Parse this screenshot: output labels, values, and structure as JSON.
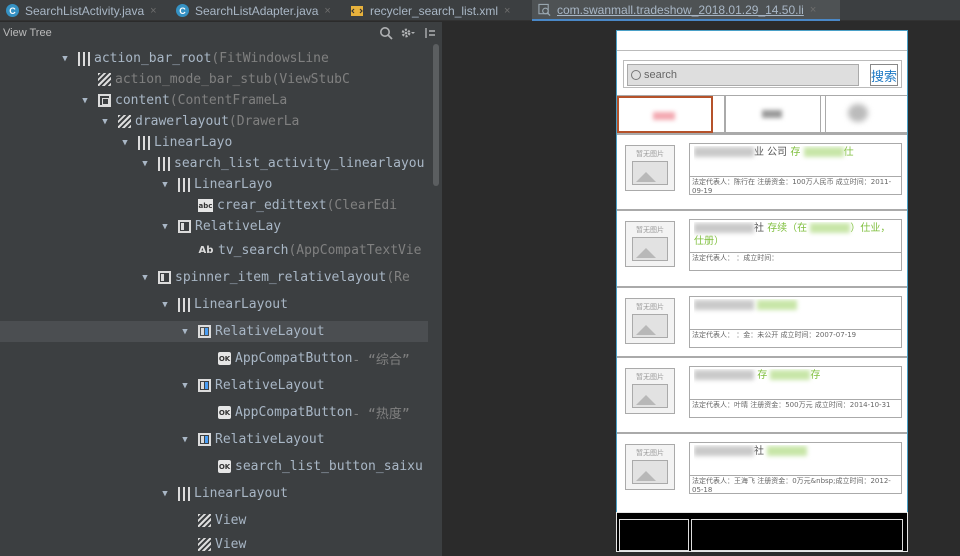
{
  "tabs": [
    {
      "label": "SearchListActivity.java",
      "icon": "c"
    },
    {
      "label": "SearchListAdapter.java",
      "icon": "c"
    },
    {
      "label": "recycler_search_list.xml",
      "icon": "xml"
    },
    {
      "label": "com.swanmall.tradeshow_2018.01.29_14.50.li",
      "icon": "img"
    }
  ],
  "view_tree": {
    "title": "View Tree",
    "rows": [
      {
        "name": "action_bar_root",
        "meta": " (FitWindowsLine",
        "icon": "linear",
        "indent": 60,
        "arrow": true
      },
      {
        "name": "action_mode_bar_stub",
        "meta": " (ViewStubC",
        "icon": "stub",
        "indent": 80,
        "arrow": false,
        "dim": true
      },
      {
        "name": "content",
        "meta": " (ContentFrameLa",
        "icon": "frame",
        "indent": 80,
        "arrow": true
      },
      {
        "name": "drawerlayout",
        "meta": " (DrawerLa",
        "icon": "stub",
        "indent": 100,
        "arrow": true
      },
      {
        "name": "LinearLayo",
        "meta": "",
        "icon": "linear",
        "indent": 120,
        "arrow": true
      },
      {
        "name": "search_list_activity_linearlayou",
        "meta": "",
        "icon": "linear",
        "indent": 140,
        "arrow": true
      },
      {
        "name": "LinearLayo",
        "meta": "",
        "icon": "linear",
        "indent": 160,
        "arrow": true
      },
      {
        "name": "crear_edittext",
        "meta": " (ClearEdi",
        "icon": "abc",
        "indent": 180,
        "arrow": false
      },
      {
        "name": "RelativeLay",
        "meta": "",
        "icon": "rel",
        "indent": 160,
        "arrow": true
      },
      {
        "name": "tv_search",
        "meta": " (AppCompatTextVie",
        "icon": "ab",
        "indent": 180,
        "arrow": false
      },
      {
        "name": "spinner_item_relativelayout",
        "meta": " (Re",
        "icon": "rel",
        "indent": 140,
        "arrow": true
      },
      {
        "name": "LinearLayout",
        "meta": "",
        "icon": "linear",
        "indent": 160,
        "arrow": true
      },
      {
        "name": "RelativeLayout",
        "meta": "",
        "icon": "relb",
        "indent": 180,
        "arrow": true,
        "selected": true
      },
      {
        "name": "AppCompatButton",
        "meta": " - “综合”",
        "icon": "ok",
        "indent": 200,
        "arrow": false
      },
      {
        "name": "RelativeLayout",
        "meta": "",
        "icon": "relb",
        "indent": 180,
        "arrow": true
      },
      {
        "name": "AppCompatButton",
        "meta": " - “热度”",
        "icon": "ok",
        "indent": 200,
        "arrow": false
      },
      {
        "name": "RelativeLayout",
        "meta": "",
        "icon": "relb",
        "indent": 180,
        "arrow": true
      },
      {
        "name": "search_list_button_saixu",
        "meta": "",
        "icon": "ok",
        "indent": 200,
        "arrow": false
      },
      {
        "name": "LinearLayout",
        "meta": "",
        "icon": "linear",
        "indent": 160,
        "arrow": true
      },
      {
        "name": "View",
        "meta": "",
        "icon": "stub",
        "indent": 180,
        "arrow": false
      },
      {
        "name": "View",
        "meta": "",
        "icon": "stub",
        "indent": 180,
        "arrow": false
      }
    ]
  },
  "device": {
    "search_placeholder": "search",
    "search_button": "搜索",
    "thumb_label": "暂无图片",
    "cards": [
      {
        "title_pre": "",
        "title_mid": "业 公司",
        "title_green": "存",
        "title_post": "仕"
      },
      {
        "title_pre": "",
        "title_mid": "社",
        "title_green": "存续（在",
        "title_post": "）仕业，仕册）"
      },
      {
        "title_pre": "",
        "title_mid": "",
        "title_green": "",
        "title_post": ""
      },
      {
        "title_pre": "",
        "title_mid": "",
        "title_green": "存",
        "title_post": "存"
      },
      {
        "title_pre": "",
        "title_mid": "社",
        "title_green": "",
        "title_post": ""
      }
    ],
    "details": [
      "法定代表人：陈行在 注册资金：100万人民币 成立时间：2011-09-19",
      "法定代表人：                 ：成立时间：",
      "法定代表人：          ：金：未公开 成立时间：2007-07-19",
      "法定代表人：叶晴 注册资金：500万元 成立时间：2014-10-31",
      "法定代表人：王海飞 注册资金：0万元&nbsp;成立时间：2012-05-18"
    ]
  },
  "colors": {
    "accent": "#4a88c7",
    "selection": "#4b4e51",
    "green_text": "#7fbf3d",
    "tab_active_border": "#4a88c7"
  }
}
